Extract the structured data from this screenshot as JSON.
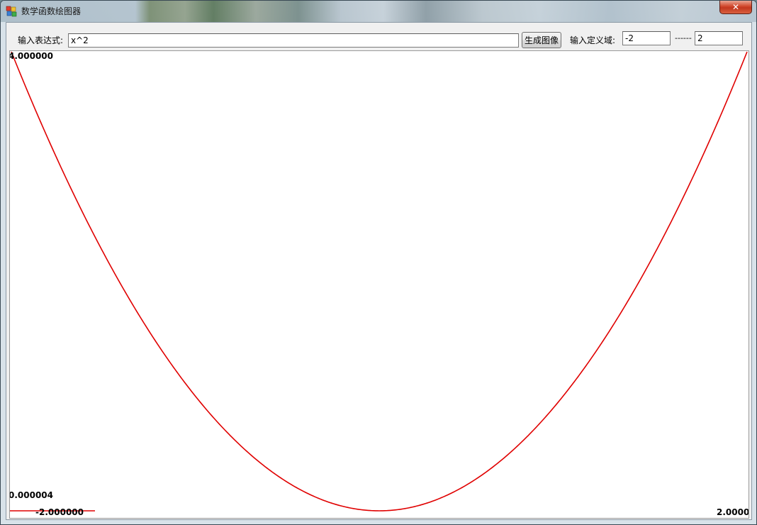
{
  "window": {
    "title": "数学函数绘图器",
    "close_glyph": "✕"
  },
  "toolbar": {
    "expression_label": "输入表达式:",
    "expression_value": "x^2",
    "generate_button_label": "生成图像",
    "domain_label": "输入定义域:",
    "domain_from": "-2",
    "domain_separator": "------",
    "domain_to": "2"
  },
  "plot": {
    "y_max_label": "4.000000",
    "y_min_label": "0.000004",
    "x_min_label": "-2.000000",
    "x_max_label": "2.0000",
    "curve_color": "#e00000"
  },
  "chart_data": {
    "type": "line",
    "expression": "x^2",
    "xlim": [
      -2,
      2
    ],
    "ylim": [
      4e-06,
      4
    ],
    "series": [
      {
        "x": [
          -2,
          -1.75,
          -1.5,
          -1.25,
          -1,
          -0.75,
          -0.5,
          -0.25,
          0,
          0.25,
          0.5,
          0.75,
          1,
          1.25,
          1.5,
          1.75,
          2
        ],
        "y": [
          4,
          3.0625,
          2.25,
          1.5625,
          1,
          0.5625,
          0.25,
          0.0625,
          0,
          0.0625,
          0.25,
          0.5625,
          1,
          1.5625,
          2.25,
          3.0625,
          4
        ],
        "color": "#e00000"
      }
    ]
  }
}
